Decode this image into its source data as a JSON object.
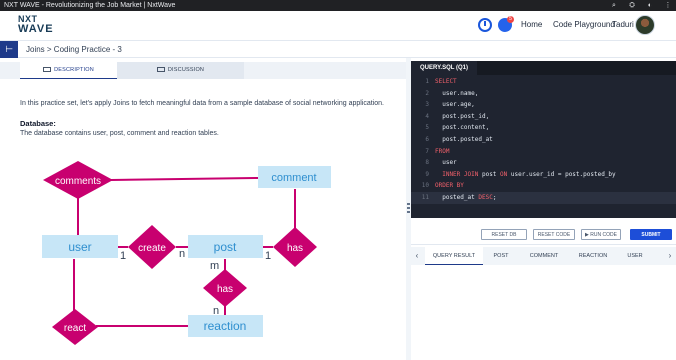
{
  "window": {
    "title": "NXT WAVE - Revolutionizing the Job Market | NxtWave",
    "controls": [
      "⌕",
      "⛭",
      "◐",
      "⋮"
    ]
  },
  "header": {
    "logo_line1": "NXT",
    "logo_line2": "WAVE",
    "notification_count": "5",
    "nav": {
      "home": "Home",
      "code_playground": "Code Playground"
    },
    "user_name": "Taduri"
  },
  "subheader": {
    "back_icon": "sidebar-toggle-icon",
    "back_glyph": "⊢",
    "breadcrumb": "Joins > Coding Practice - 3"
  },
  "left": {
    "tabs": [
      {
        "label": "DESCRIPTION",
        "active": true
      },
      {
        "label": "DISCUSSION",
        "active": false
      }
    ],
    "description": "In this practice set, let's apply Joins to fetch meaningful data from a sample database of social networking application.",
    "database_heading": "Database:",
    "database_text": "The database contains user, post, comment and reaction tables."
  },
  "er_diagram": {
    "entities": {
      "user": "user",
      "post": "post",
      "comment": "comment",
      "reaction": "reaction"
    },
    "relationships": {
      "comments": "comments",
      "create": "create",
      "has_comment": "has",
      "has_reaction": "has",
      "react": "react"
    },
    "cardinality": {
      "user_create": "1",
      "create_post": "n",
      "post_has": "1",
      "post_m": "m",
      "reaction_n": "n"
    },
    "colors": {
      "entity_fill": "#c7e6f7",
      "entity_text": "#2f8fcf",
      "relation_fill": "#c8006f",
      "line": "#c8006f"
    }
  },
  "editor": {
    "tab_label": "QUERY.SQL (Q1)",
    "lines": [
      {
        "n": "1",
        "parts": [
          {
            "t": "SELECT",
            "kw": true
          }
        ]
      },
      {
        "n": "2",
        "parts": [
          {
            "t": "  user.name,",
            "kw": false
          }
        ]
      },
      {
        "n": "3",
        "parts": [
          {
            "t": "  user.age,",
            "kw": false
          }
        ]
      },
      {
        "n": "4",
        "parts": [
          {
            "t": "  post.post_id,",
            "kw": false
          }
        ]
      },
      {
        "n": "5",
        "parts": [
          {
            "t": "  post.content,",
            "kw": false
          }
        ]
      },
      {
        "n": "6",
        "parts": [
          {
            "t": "  post.posted_at",
            "kw": false
          }
        ]
      },
      {
        "n": "7",
        "parts": [
          {
            "t": "FROM",
            "kw": true
          }
        ]
      },
      {
        "n": "8",
        "parts": [
          {
            "t": "  user",
            "kw": false
          }
        ]
      },
      {
        "n": "9",
        "parts": [
          {
            "t": "  INNER JOIN",
            "kw": true
          },
          {
            "t": " post ",
            "kw": false
          },
          {
            "t": "ON",
            "kw": true
          },
          {
            "t": " user.user_id = post.posted_by",
            "kw": false
          }
        ]
      },
      {
        "n": "10",
        "parts": [
          {
            "t": "ORDER BY",
            "kw": true
          }
        ]
      },
      {
        "n": "11",
        "parts": [
          {
            "t": "  posted_at ",
            "kw": false
          },
          {
            "t": "DESC",
            "kw": true
          },
          {
            "t": ";",
            "kw": false
          }
        ],
        "active": true
      }
    ]
  },
  "actions": {
    "reset_db": "RESET DB",
    "reset_code": "RESET CODE",
    "run_code": "▶ RUN CODE",
    "submit": "SUBMIT"
  },
  "results": {
    "tabs": [
      "QUERY RESULT",
      "POST",
      "COMMENT",
      "REACTION",
      "USER"
    ],
    "active_tab": "QUERY RESULT",
    "left_arrow": "‹",
    "right_arrow": "›"
  }
}
